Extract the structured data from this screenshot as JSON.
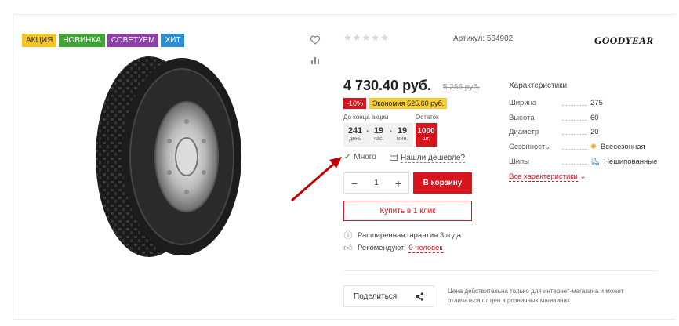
{
  "badges": [
    {
      "label": "АКЦИЯ",
      "color": "#f5c425"
    },
    {
      "label": "НОВИНКА",
      "color": "#3fa535"
    },
    {
      "label": "СОВЕТУЕМ",
      "color": "#8e3fad"
    },
    {
      "label": "ХИТ",
      "color": "#2a8fd6"
    }
  ],
  "product": {
    "rating_stars": "★★★★★",
    "article": "Артикул: 564902",
    "brand": "GOODYEAR",
    "price": "4 730.40 руб.",
    "old_price": "5 256 руб.",
    "discount": "-10%",
    "economy": "Экономия 525.60 руб."
  },
  "timer": {
    "label": "До конца акции",
    "days": "241",
    "days_label": "день",
    "hours": "19",
    "hours_label": "час.",
    "minutes": "19",
    "minutes_label": "мин."
  },
  "stock": {
    "label": "Остаток",
    "value": "1000",
    "unit": "шт.",
    "availability": "Много",
    "cheaper_link": "Нашли дешевле?"
  },
  "cart": {
    "qty": "1",
    "minus": "−",
    "plus": "+",
    "add_button": "В корзину",
    "one_click": "Купить в 1 клик"
  },
  "info": {
    "warranty": "Расширенная гарантия 3 года",
    "recommend_prefix": "Рекомендуют",
    "recommend_link": "0 человек"
  },
  "share": {
    "label": "Поделиться",
    "note": "Цена действительна только для интернет-магазина и может отличаться от цен в розничных магазинах"
  },
  "characteristics": {
    "title": "Характеристики",
    "rows": [
      {
        "key": "Ширина",
        "value": "275"
      },
      {
        "key": "Высота",
        "value": "60"
      },
      {
        "key": "Диаметр",
        "value": "20"
      },
      {
        "key": "Сезонность",
        "value": "Всесезонная",
        "icon": "all-season-icon"
      },
      {
        "key": "Шипы",
        "value": "Нешипованные",
        "icon": "no-studs-icon"
      }
    ],
    "all_link": "Все характеристики"
  },
  "colors": {
    "accent": "#d8141f",
    "economy": "#f7cc2f",
    "check": "#55a630",
    "arrow": "#c00000"
  }
}
